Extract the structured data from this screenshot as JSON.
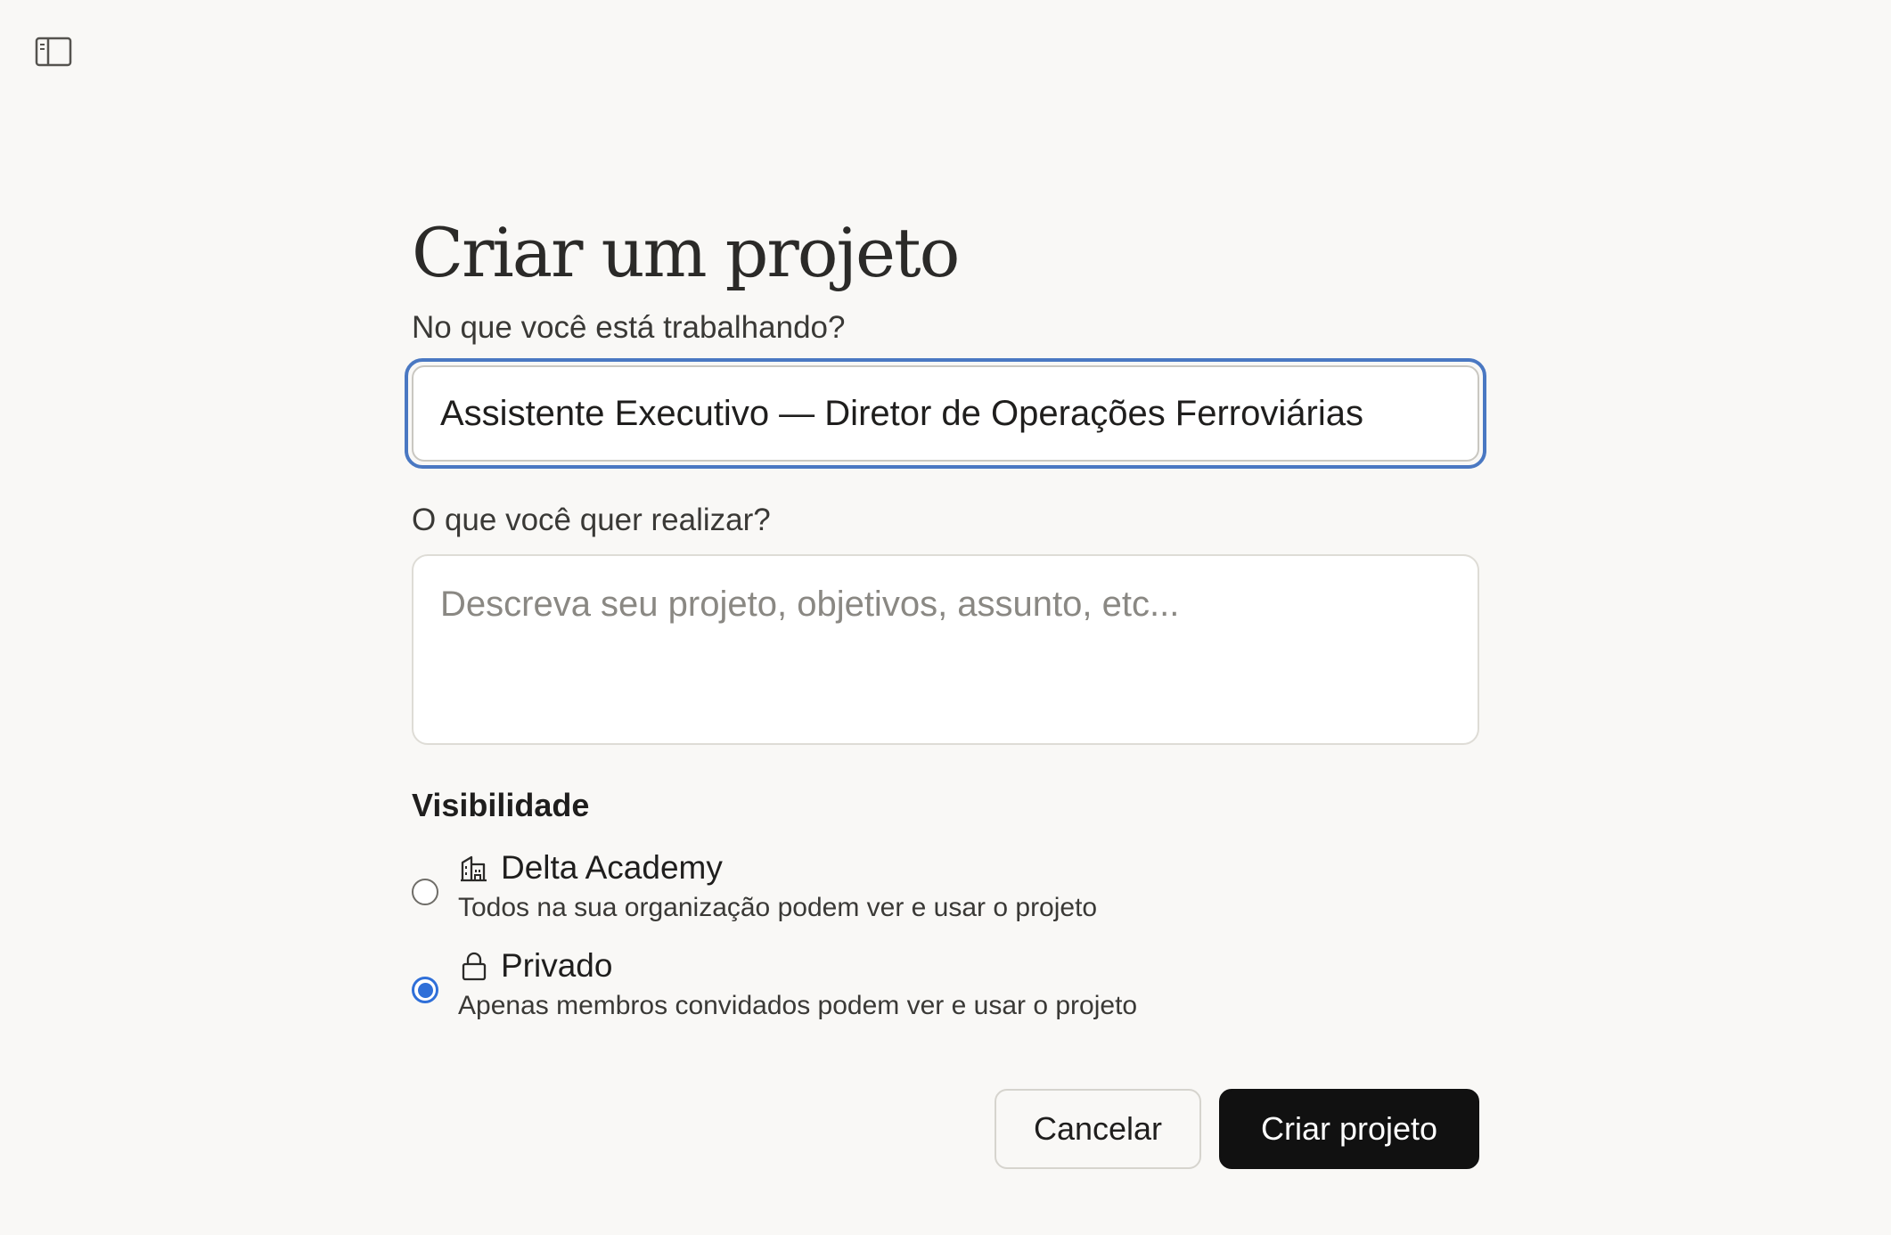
{
  "sidebar_toggle": {
    "icon": "sidebar-panel-icon"
  },
  "form": {
    "title": "Criar um projeto",
    "name_label": "No que você está trabalhando?",
    "name_value": "Assistente Executivo — Diretor de Operações Ferroviárias",
    "description_label": "O que você quer realizar?",
    "description_placeholder": "Descreva seu projeto, objetivos, assunto, etc...",
    "description_value": "",
    "visibility_heading": "Visibilidade",
    "visibility_options": [
      {
        "icon": "building-icon",
        "title": "Delta Academy",
        "description": "Todos na sua organização podem ver e usar o projeto",
        "selected": false
      },
      {
        "icon": "lock-icon",
        "title": "Privado",
        "description": "Apenas membros convidados podem ver e usar o projeto",
        "selected": true
      }
    ]
  },
  "actions": {
    "cancel_label": "Cancelar",
    "create_label": "Criar projeto"
  },
  "colors": {
    "background": "#f9f8f6",
    "focus_ring": "#4a78c2",
    "radio_selected": "#2f6fd8",
    "primary_button": "#111111"
  }
}
